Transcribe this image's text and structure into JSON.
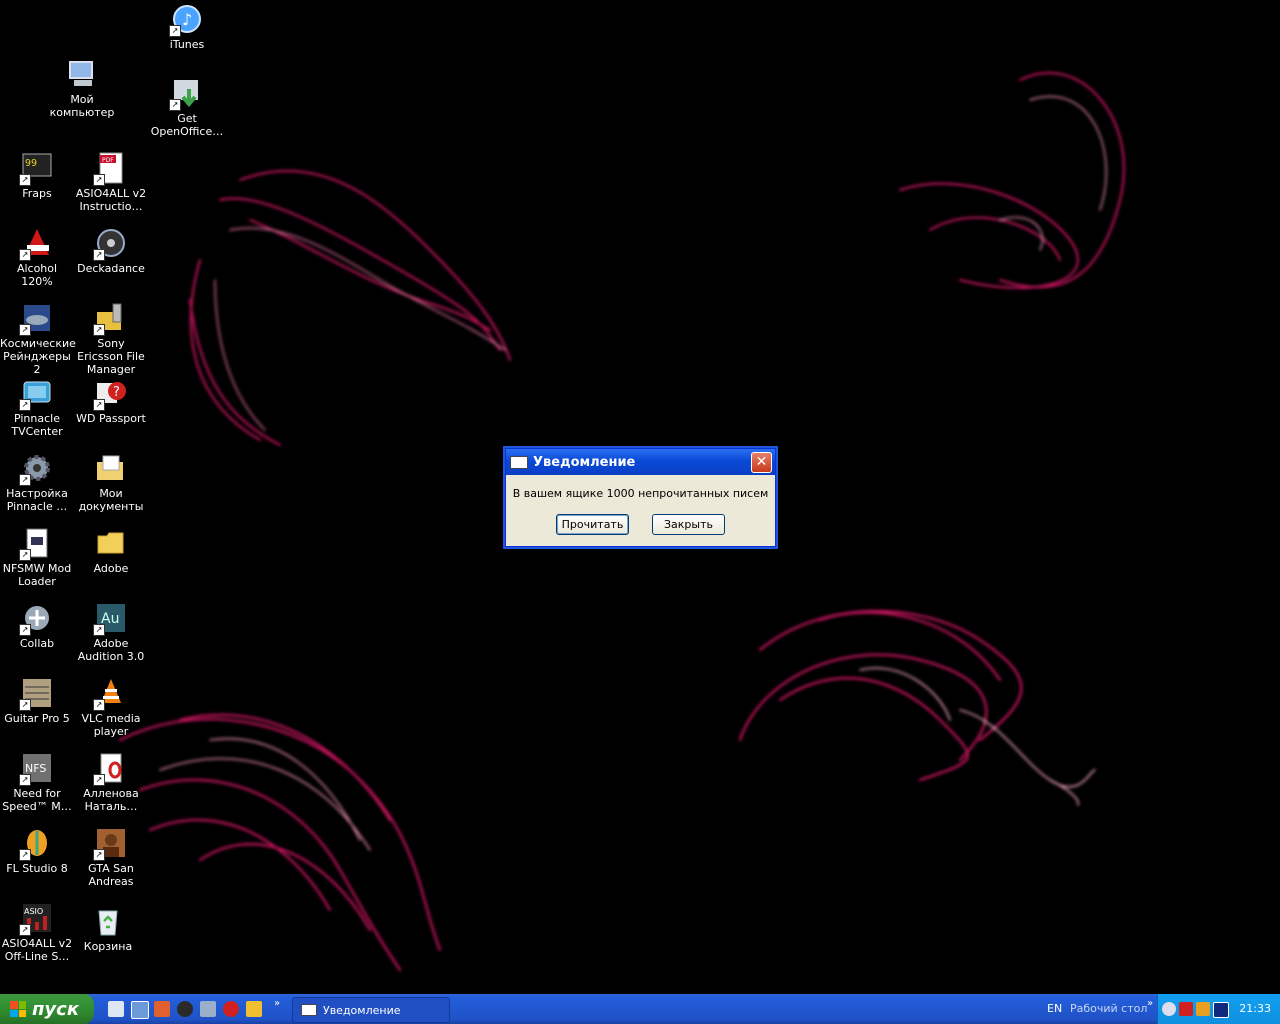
{
  "desktop": {
    "icons": [
      {
        "label": "iTunes",
        "icon": "itunes-icon",
        "color": "#4aa3ff"
      },
      {
        "label": "Мой компьютер",
        "icon": "computer-icon",
        "color": "#8fb8e8"
      },
      {
        "label": "Get OpenOffice…",
        "icon": "openoffice-download-icon",
        "color": "#3aa34a"
      },
      {
        "label": "Fraps",
        "icon": "fraps-icon",
        "color": "#e8d020"
      },
      {
        "label": "ASIO4ALL v2 Instructio…",
        "icon": "pdf-icon",
        "color": "#c8102e"
      },
      {
        "label": "Alcohol 120%",
        "icon": "alcohol-icon",
        "color": "#d01818"
      },
      {
        "label": "Deckadance",
        "icon": "deckadance-icon",
        "color": "#5a6a7a"
      },
      {
        "label": "Космические Рейнджеры 2",
        "icon": "space-rangers-icon",
        "color": "#2a4a8a"
      },
      {
        "label": "Sony Ericsson File Manager",
        "icon": "folder-phone-icon",
        "color": "#e8c040"
      },
      {
        "label": "Pinnacle TVCenter",
        "icon": "pinnacle-tv-icon",
        "color": "#3aa0d8"
      },
      {
        "label": "WD Passport",
        "icon": "help-icon",
        "color": "#d02020"
      },
      {
        "label": "Настройка Pinnacle …",
        "icon": "gear-icon",
        "color": "#8a9aaa"
      },
      {
        "label": "Мои документы",
        "icon": "my-documents-icon",
        "color": "#f0d070"
      },
      {
        "label": "NFSMW Mod Loader",
        "icon": "document-icon",
        "color": "#e0e8f0"
      },
      {
        "label": "Adobe",
        "icon": "folder-icon",
        "color": "#f2cf5a"
      },
      {
        "label": "Collab",
        "icon": "collab-icon",
        "color": "#9aa8b8"
      },
      {
        "label": "Adobe Audition 3.0",
        "icon": "audition-icon",
        "color": "#2a5a6a"
      },
      {
        "label": "Guitar Pro 5",
        "icon": "guitar-pro-icon",
        "color": "#b0a080"
      },
      {
        "label": "VLC media player",
        "icon": "vlc-icon",
        "color": "#f08010"
      },
      {
        "label": "Need for Speed™ M…",
        "icon": "nfs-icon",
        "color": "#707070"
      },
      {
        "label": "Алленова Наталь…",
        "icon": "opera-document-icon",
        "color": "#d02020"
      },
      {
        "label": "FL Studio 8",
        "icon": "fl-studio-icon",
        "color": "#f0a020"
      },
      {
        "label": "GTA San Andreas",
        "icon": "gta-icon",
        "color": "#a06030"
      },
      {
        "label": "ASIO4ALL v2 Off-Line S…",
        "icon": "asio-icon",
        "color": "#c02020"
      },
      {
        "label": "Корзина",
        "icon": "recycle-bin-icon",
        "color": "#4ab04a"
      }
    ]
  },
  "dialog": {
    "title": "Уведомление",
    "message": "В вашем ящике 1000 непрочитанных писем",
    "read_label": "Прочитать",
    "close_label": "Закрыть"
  },
  "taskbar": {
    "start_label": "пуск",
    "task_label": "Уведомление",
    "lang": "EN",
    "desktop_toolbar_label": "Рабочий стол",
    "clock": "21:33",
    "quicklaunch_chevron": "»",
    "toolbar_chevron": "»"
  },
  "colors": {
    "taskbar_blue": "#245edb",
    "start_green": "#3c9a3c",
    "dialog_bg": "#ece9d8",
    "wallpaper_streak": "#ff2a6a"
  }
}
